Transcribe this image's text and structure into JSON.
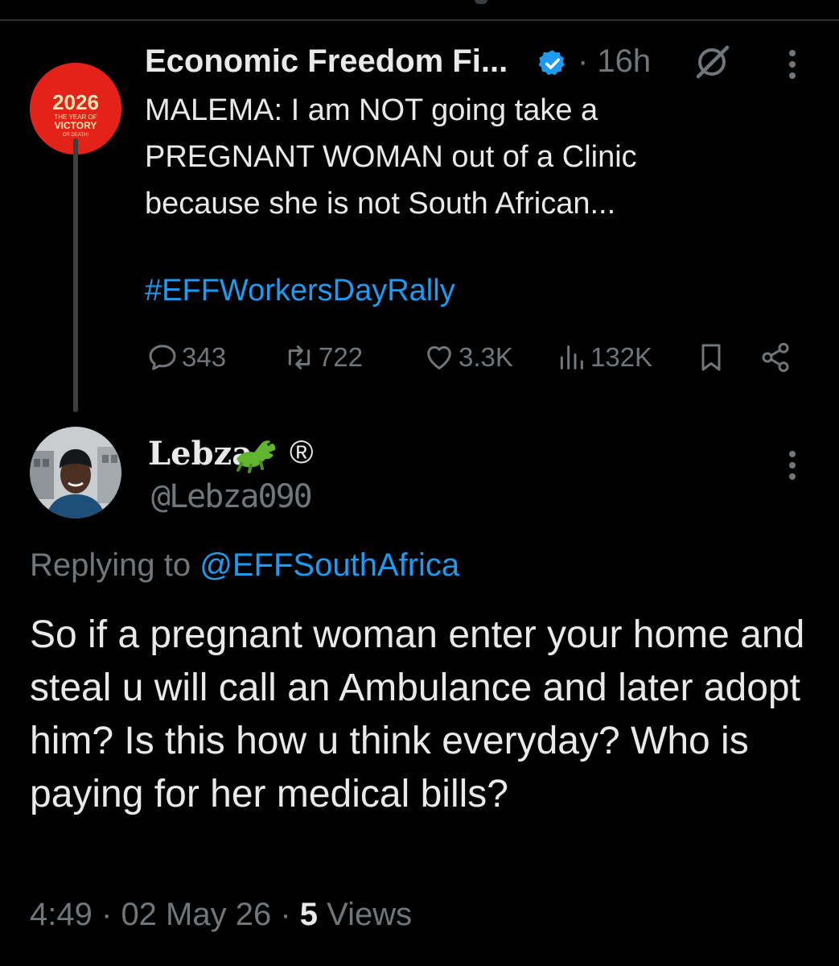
{
  "parent_tweet": {
    "author_name": "Economic Freedom Fi...",
    "time": "· 16h",
    "text": "MALEMA: I am NOT going take a\nPREGNANT WOMAN out of a Clinic\nbecause she is not South African...",
    "hashtag": "#EFFWorkersDayRally",
    "avatar_text": {
      "year": "2026",
      "line1": "THE YEAR OF",
      "line2": "VICTORY",
      "line3": "OR DEATH!"
    },
    "actions": {
      "replies": "343",
      "reposts": "722",
      "likes": "3.3K",
      "views": "132K"
    },
    "colors": {
      "verified": "#1d9bf0",
      "avatar_bg": "#e32219"
    }
  },
  "reply_tweet": {
    "author_name": "Lebza",
    "author_emoji": "crocodile-icon",
    "registered_mark": "®",
    "handle": "@Lebza090",
    "replying_prefix": "Replying to",
    "replying_to": "@EFFSouthAfrica",
    "text": "So if a pregnant woman enter your home and steal u will call an Ambulance and later adopt him? Is this how u think everyday? Who is paying for her medical bills?",
    "time": "4:49",
    "date": "02 May 26",
    "views_count": "5",
    "views_label": "Views"
  },
  "colors": {
    "accent": "#1d9bf0",
    "muted": "#71767b",
    "text": "#e7e9ea",
    "background": "#000000"
  }
}
